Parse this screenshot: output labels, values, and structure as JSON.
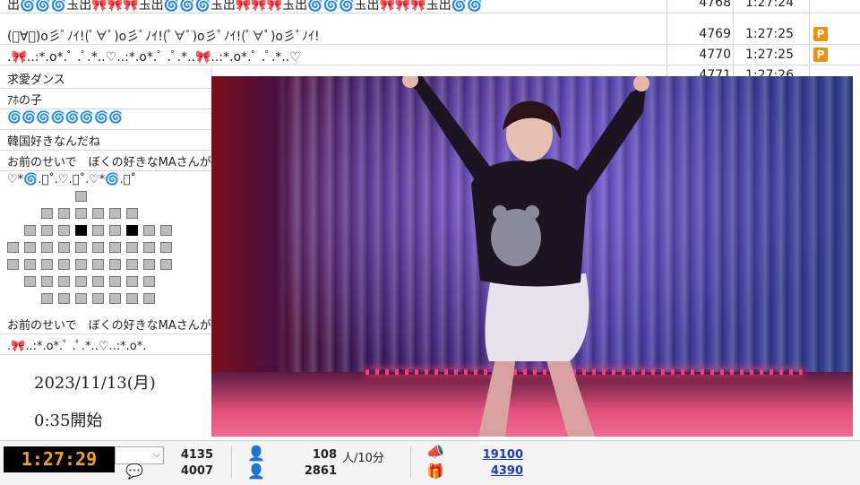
{
  "comments": [
    {
      "text": "出🌀🌀🌀玉出🎀🎀🎀玉出🌀🌀🌀玉出🎀🎀🎀玉出🌀🌀🌀玉出🎀🎀🎀玉出🌀🌀",
      "num": "4768",
      "time": "1:27:24",
      "badge": ""
    },
    {
      "text": "(ﾟ∀ﾟ)o彡ﾟﾉｲ!(ﾟ∀ﾟ)o彡ﾟﾉｲ!(ﾟ∀ﾟ)o彡ﾟﾉｲ!(ﾟ∀ﾟ)o彡ﾟﾉｲ!",
      "num": "4769",
      "time": "1:27:25",
      "badge": "P"
    },
    {
      "text": ".🎀..:*.o*.ﾟ .ﾟ.*..♡..:*.o*.ﾟ .ﾟ.*..🎀..:*.o*.ﾟ .ﾟ.*..♡",
      "num": "4770",
      "time": "1:27:25",
      "badge": "P"
    },
    {
      "text": "",
      "num": "4771",
      "time": "1:27:26",
      "badge": ""
    }
  ],
  "sidebar": {
    "items": [
      "求愛ダンス",
      "ｱﾎの子",
      "🌀🌀🌀🌀🌀🌀🌀🌀",
      "韓国好きなんだね",
      "お前のせいで　ぼくの好きなMAさんが",
      "♡*🌀.ﾟ˚.♡.ﾟ˚.♡*🌀.ﾟ˚",
      "お前のせいで　ぼくの好きなMAさんが",
      ".🎀..:*.o*.ﾟ .ﾟ.*..♡..:*.o*."
    ]
  },
  "stream": {
    "date": "2023/11/13(月)",
    "start": "0:35開始"
  },
  "status": {
    "elapsed": "1:27:29",
    "stat_a_top": "4135",
    "stat_a_bottom": "4007",
    "viewers_rate": "108",
    "viewers_unit": "人/10分",
    "total": "2861",
    "points": "19100",
    "gifts": "4390"
  },
  "icons": {
    "comment": "comment-icon",
    "viewer": "person-icon",
    "total": "people-icon",
    "ad": "megaphone-icon",
    "gift": "gift-icon"
  },
  "colors": {
    "timer_bg": "#000000",
    "timer_fg": "#f0a020",
    "badge": "#f0900a",
    "link": "#1a3ac0"
  }
}
